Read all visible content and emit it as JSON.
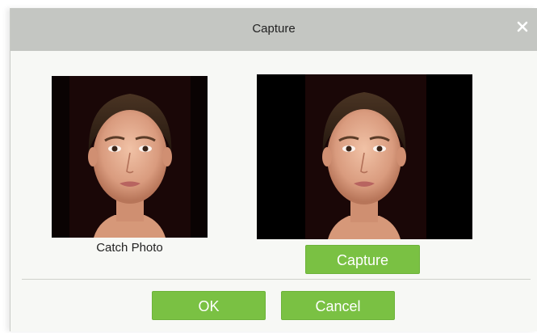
{
  "dialog": {
    "title": "Capture",
    "close_icon": "close-icon"
  },
  "photos": {
    "catch_caption": "Catch Photo"
  },
  "buttons": {
    "capture": "Capture",
    "ok": "OK",
    "cancel": "Cancel"
  },
  "colors": {
    "titlebar": "#c4c6c2",
    "dialog_background": "#f7f8f5",
    "button_green": "#7ac143",
    "photo_background": "#000000"
  }
}
